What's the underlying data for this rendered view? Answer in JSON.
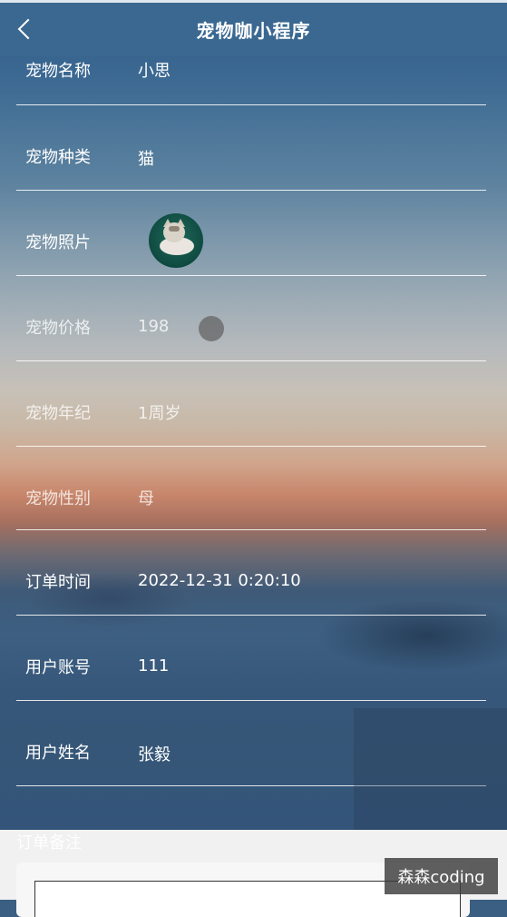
{
  "header": {
    "title": "宠物咖小程序"
  },
  "rows": [
    {
      "label": "宠物名称",
      "value": "小思"
    },
    {
      "label": "宠物种类",
      "value": "猫"
    },
    {
      "label": "宠物照片",
      "value": ""
    },
    {
      "label": "宠物价格",
      "value": "198"
    },
    {
      "label": "宠物年纪",
      "value": "1周岁"
    },
    {
      "label": "宠物性别",
      "value": "母"
    },
    {
      "label": "订单时间",
      "value": "2022-12-31 0:20:10"
    },
    {
      "label": "用户账号",
      "value": "111"
    },
    {
      "label": "用户姓名",
      "value": "张毅"
    }
  ],
  "remark": {
    "label": "订单备注",
    "value": ""
  },
  "watermark": "森森coding",
  "icons": {
    "back": "chevron-left-icon",
    "avatar": "pet-photo"
  }
}
